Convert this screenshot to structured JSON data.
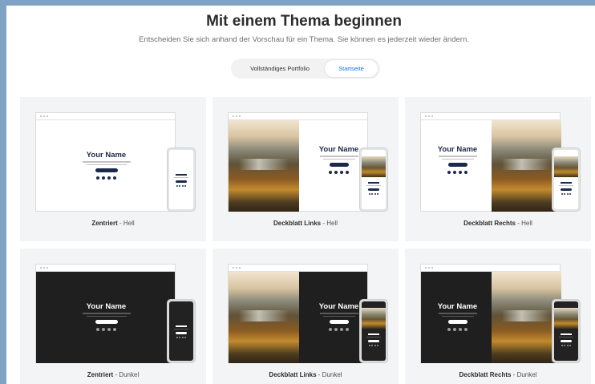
{
  "header": {
    "title": "Mit einem Thema beginnen",
    "subtitle": "Entscheiden Sie sich anhand der Vorschau für ein Thema. Sie können es jederzeit wieder ändern."
  },
  "toggle": {
    "options": [
      "Vollständiges Portfolio",
      "Startseite"
    ],
    "selected": "Startseite"
  },
  "preview": {
    "name": "Your Name"
  },
  "themes": [
    {
      "name": "Zentriert",
      "variant": "Hell"
    },
    {
      "name": "Deckblatt Links",
      "variant": "Hell"
    },
    {
      "name": "Deckblatt Rechts",
      "variant": "Hell"
    },
    {
      "name": "Zentriert",
      "variant": "Dunkel"
    },
    {
      "name": "Deckblatt Links",
      "variant": "Dunkel"
    },
    {
      "name": "Deckblatt Rechts",
      "variant": "Dunkel"
    }
  ],
  "separator": " - ",
  "colors": {
    "accent": "#1473e6",
    "navy": "#1b2a4a",
    "dark_bg": "#1f1f1f",
    "card_bg": "#f3f4f6"
  }
}
